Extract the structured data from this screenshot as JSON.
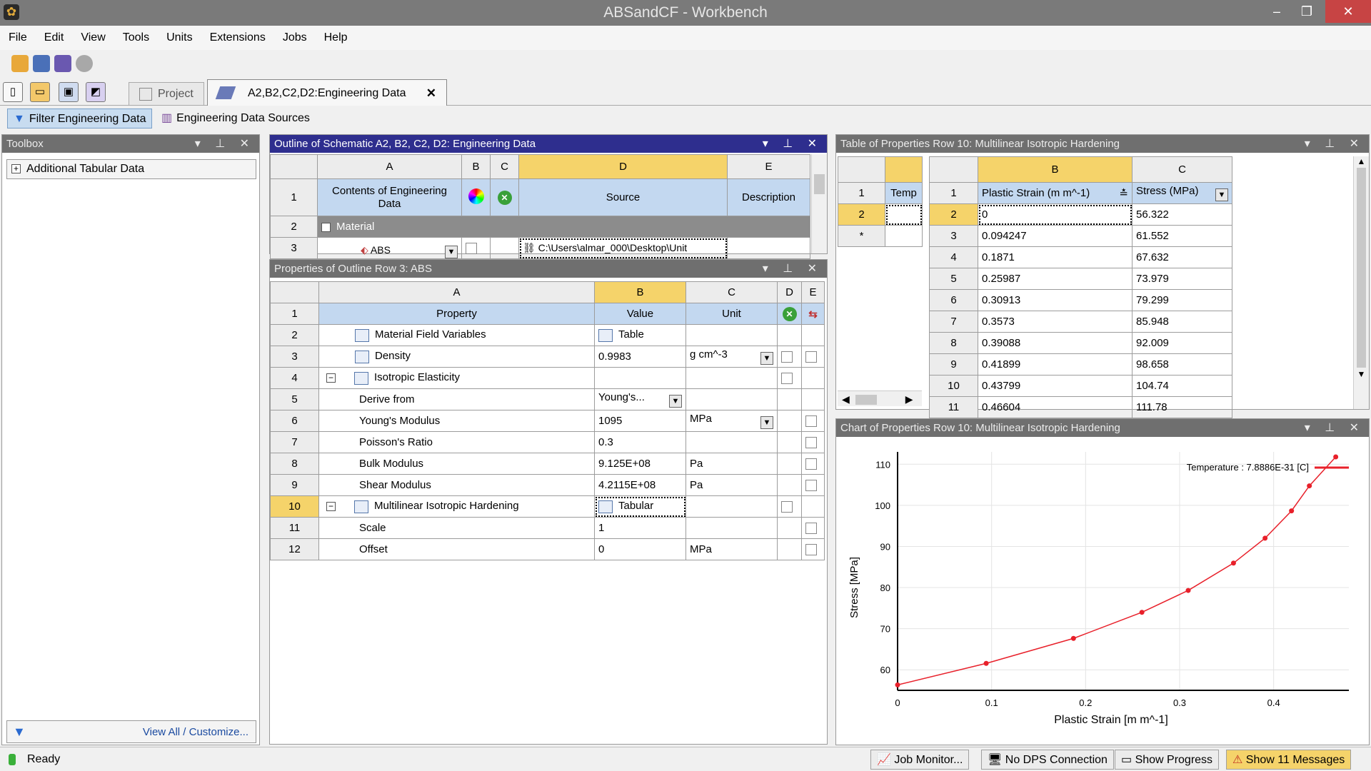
{
  "window": {
    "title": "ABSandCF - Workbench",
    "min": "–",
    "max": "❐",
    "close": "✕"
  },
  "menu": [
    "File",
    "Edit",
    "View",
    "Tools",
    "Units",
    "Extensions",
    "Jobs",
    "Help"
  ],
  "tabs": {
    "project": "Project",
    "engineering": "A2,B2,C2,D2:Engineering Data",
    "close": "✕"
  },
  "toolbar3": {
    "filter": "Filter Engineering Data",
    "sources": "Engineering Data Sources"
  },
  "toolbox": {
    "title": "Toolbox",
    "item": "Additional Tabular Data",
    "view_all": "View All / Customize..."
  },
  "outline": {
    "title": "Outline of Schematic A2, B2, C2, D2: Engineering Data",
    "cols": [
      "A",
      "B",
      "C",
      "D",
      "E"
    ],
    "h_contents": "Contents of Engineering Data",
    "h_source": "Source",
    "h_description": "Description",
    "r2": "Material",
    "r3": "ABS",
    "r3_source": "C:\\Users\\almar_000\\Desktop\\Unit"
  },
  "props": {
    "title": "Properties of Outline Row 3: ABS",
    "cols": [
      "A",
      "B",
      "C",
      "D",
      "E"
    ],
    "h_property": "Property",
    "h_value": "Value",
    "h_unit": "Unit",
    "rows": [
      {
        "n": "2",
        "name": "Material Field Variables",
        "value": "Table",
        "unit": ""
      },
      {
        "n": "3",
        "name": "Density",
        "value": "0.9983",
        "unit": "g cm^-3"
      },
      {
        "n": "4",
        "name": "Isotropic Elasticity",
        "value": "",
        "unit": ""
      },
      {
        "n": "5",
        "name": "Derive from",
        "value": "Young's...",
        "unit": ""
      },
      {
        "n": "6",
        "name": "Young's Modulus",
        "value": "1095",
        "unit": "MPa"
      },
      {
        "n": "7",
        "name": "Poisson's Ratio",
        "value": "0.3",
        "unit": ""
      },
      {
        "n": "8",
        "name": "Bulk Modulus",
        "value": "9.125E+08",
        "unit": "Pa"
      },
      {
        "n": "9",
        "name": "Shear Modulus",
        "value": "4.2115E+08",
        "unit": "Pa"
      },
      {
        "n": "10",
        "name": "Multilinear Isotropic Hardening",
        "value": "Tabular",
        "unit": ""
      },
      {
        "n": "11",
        "name": "Scale",
        "value": "1",
        "unit": ""
      },
      {
        "n": "12",
        "name": "Offset",
        "value": "0",
        "unit": "MPa"
      }
    ]
  },
  "tableprops": {
    "title": "Table of Properties Row 10: Multilinear Isotropic Hardening",
    "left_header": "Temp",
    "left_rows": [
      "1",
      "2",
      "*"
    ],
    "cols": [
      "B",
      "C"
    ],
    "h_strain": "Plastic Strain (m m^-1)",
    "h_stress": "Stress (MPa)",
    "rows": [
      {
        "n": "2",
        "s": "0",
        "p": "56.322"
      },
      {
        "n": "3",
        "s": "0.094247",
        "p": "61.552"
      },
      {
        "n": "4",
        "s": "0.1871",
        "p": "67.632"
      },
      {
        "n": "5",
        "s": "0.25987",
        "p": "73.979"
      },
      {
        "n": "6",
        "s": "0.30913",
        "p": "79.299"
      },
      {
        "n": "7",
        "s": "0.3573",
        "p": "85.948"
      },
      {
        "n": "8",
        "s": "0.39088",
        "p": "92.009"
      },
      {
        "n": "9",
        "s": "0.41899",
        "p": "98.658"
      },
      {
        "n": "10",
        "s": "0.43799",
        "p": "104.74"
      },
      {
        "n": "11",
        "s": "0.46604",
        "p": "111.78"
      }
    ]
  },
  "chart_title": "Chart of Properties Row 10: Multilinear Isotropic Hardening",
  "chart_data": {
    "type": "line",
    "xlabel": "Plastic Strain  [m m^-1]",
    "ylabel": "Stress  [MPa]",
    "xlim": [
      0,
      0.48
    ],
    "ylim": [
      55,
      113
    ],
    "xticks": [
      "0",
      "0.1",
      "0.2",
      "0.3",
      "0.4"
    ],
    "yticks": [
      "60",
      "70",
      "80",
      "90",
      "100",
      "110"
    ],
    "series": [
      {
        "name": "Temperature : 7.8886E-31 [C]",
        "color": "#e8202a",
        "x": [
          0,
          0.094247,
          0.1871,
          0.25987,
          0.30913,
          0.3573,
          0.39088,
          0.41899,
          0.43799,
          0.46604
        ],
        "y": [
          56.322,
          61.552,
          67.632,
          73.979,
          79.299,
          85.948,
          92.009,
          98.658,
          104.74,
          111.78
        ]
      }
    ]
  },
  "status": {
    "ready": "Ready",
    "job": "Job Monitor...",
    "dps": "No DPS Connection",
    "progress": "Show Progress",
    "messages": "Show 11 Messages"
  }
}
